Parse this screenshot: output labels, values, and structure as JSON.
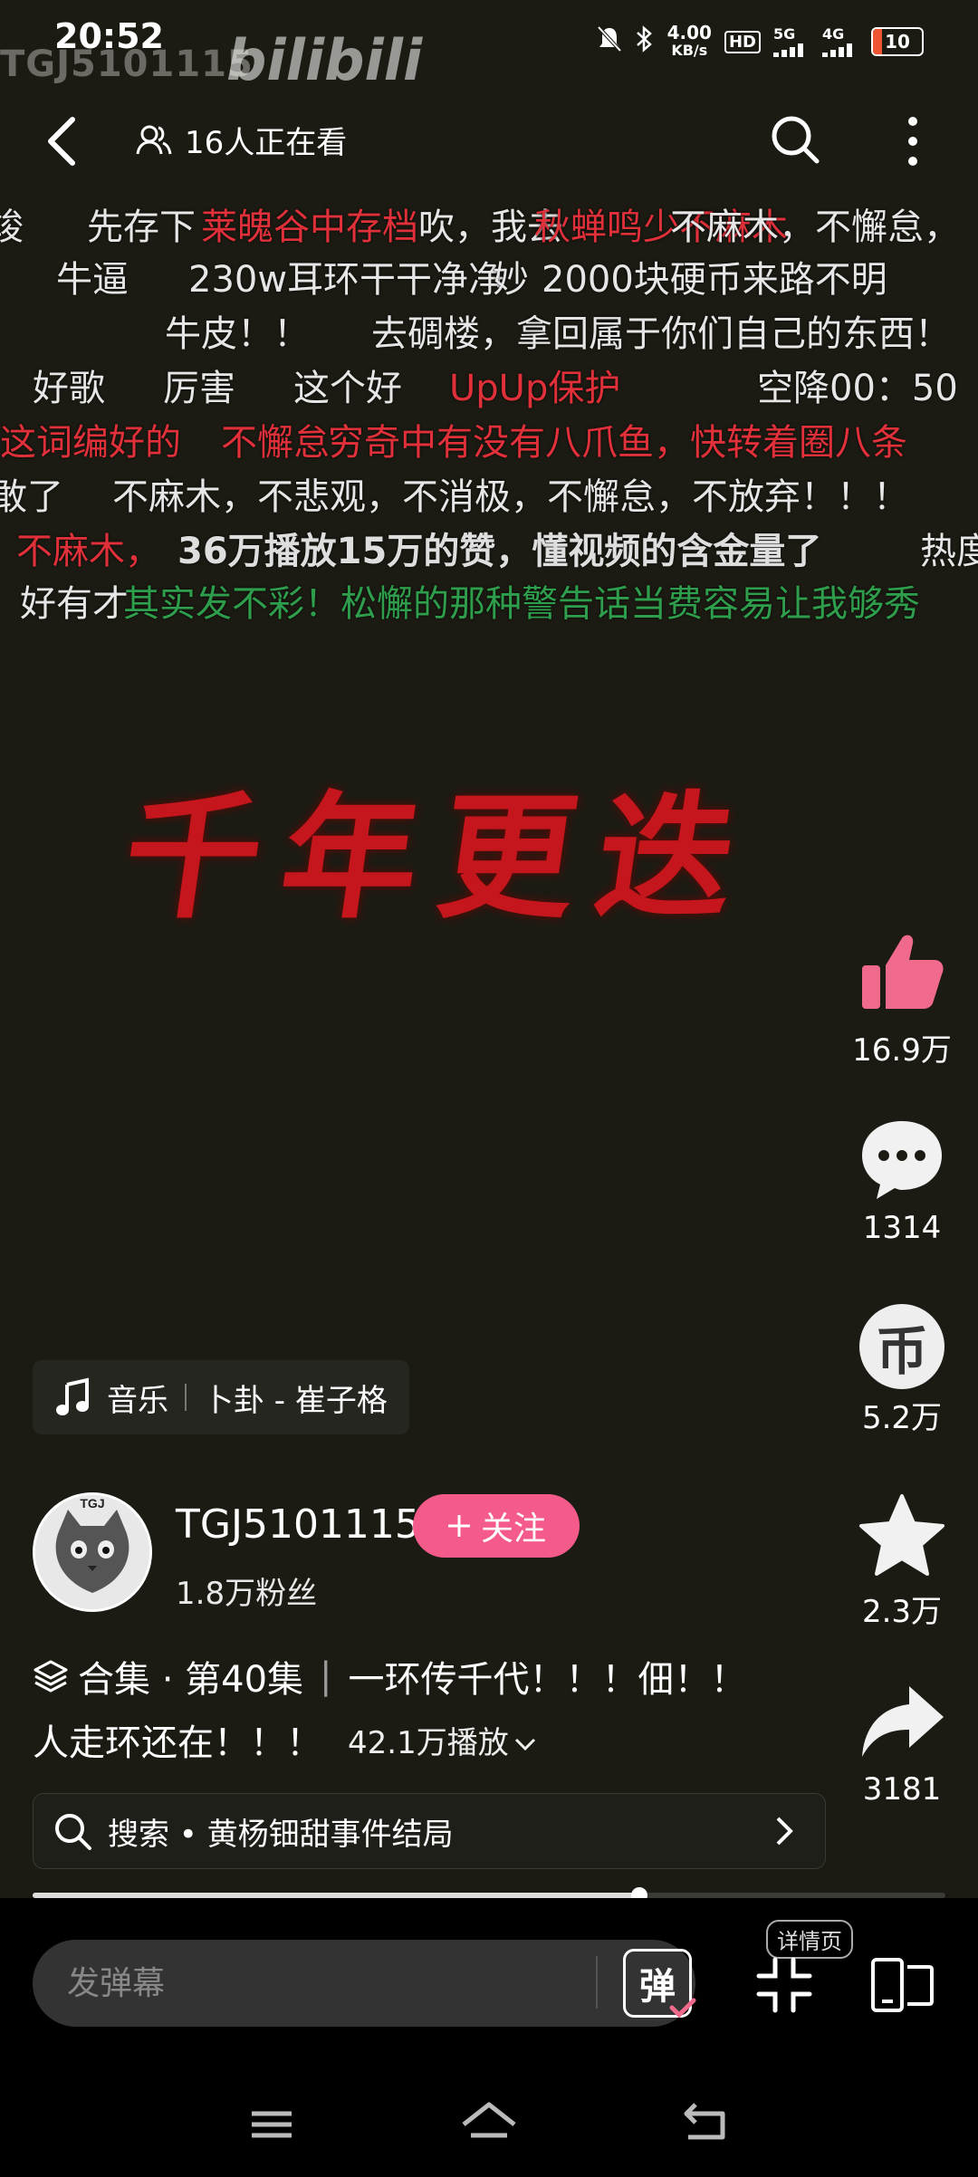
{
  "status": {
    "time": "20:52",
    "net_speed_top": "4.00",
    "net_speed_unit": "KB/s",
    "hd": "HD",
    "signal_1": "5G",
    "signal_2": "4G",
    "battery": "10"
  },
  "watermark": {
    "user": "TGJ5101115",
    "logo": "bilibili"
  },
  "topbar": {
    "viewers": "16人正在看"
  },
  "danmaku": [
    {
      "text": "竣",
      "color": "w"
    },
    {
      "text": "先存下",
      "color": "w"
    },
    {
      "text": "莱魄谷中存档",
      "color": "r"
    },
    {
      "text": "吹，我去",
      "color": "w"
    },
    {
      "text": "秋蝉鸣少不麻木",
      "color": "r"
    },
    {
      "text": "不麻木，不懈怠，",
      "color": "w"
    },
    {
      "text": "牛逼",
      "color": "w"
    },
    {
      "text": "230w耳环干干净净",
      "color": "w"
    },
    {
      "text": "妙",
      "color": "w"
    },
    {
      "text": "2000块硬币来路不明",
      "color": "w"
    },
    {
      "text": "牛皮！！",
      "color": "w"
    },
    {
      "text": "去碉楼，拿回属于你们自己的东西！",
      "color": "w"
    },
    {
      "text": "好歌",
      "color": "w"
    },
    {
      "text": "厉害",
      "color": "w"
    },
    {
      "text": "这个好",
      "color": "w"
    },
    {
      "text": "UpUp保护",
      "color": "r"
    },
    {
      "text": "空降00：50",
      "color": "w"
    },
    {
      "text": "这词编好的",
      "color": "r"
    },
    {
      "text": "不懈怠",
      "color": "r"
    },
    {
      "text": "穷奇中有没有八爪鱼，快转着圈八条",
      "color": "r"
    },
    {
      "text": "敢了",
      "color": "w"
    },
    {
      "text": "不麻木，不悲观，不消极，不懈怠，不放弃！！！",
      "color": "w"
    },
    {
      "text": "不麻木，",
      "color": "r"
    },
    {
      "text": "36万播放15万的赞，懂视频的含金量了",
      "color": "b"
    },
    {
      "text": "热度",
      "color": "w"
    },
    {
      "text": "好有才",
      "color": "w"
    },
    {
      "text": "其实发不彩！松懈的那种警告话当费容易让我够秀",
      "color": "g"
    }
  ],
  "video": {
    "title_art": "千年更迭"
  },
  "rail": {
    "likes": "16.9万",
    "comments": "1314",
    "coins": "5.2万",
    "favorites": "2.3万",
    "shares": "3181"
  },
  "music": {
    "label": "音乐",
    "song": "卜卦 - 崔子格"
  },
  "author": {
    "avatar_text": "TGJ",
    "name": "TGJ5101115",
    "follow_label": "关注",
    "fans": "1.8万粉丝"
  },
  "description": {
    "collection": "合集 · 第40集",
    "line1_text": "一环传千代！！！佃！！",
    "line2_text": "人走环还在！！！",
    "plays": "42.1万播放"
  },
  "search_suggestion": {
    "text": "搜索 • 黄杨钿甜事件结局"
  },
  "progress": {
    "played_fraction": 0.665
  },
  "bottom": {
    "danmaku_placeholder": "发弹幕",
    "danmaku_toggle": "弹",
    "detail_tip": "详情页"
  },
  "colors": {
    "accent_pink": "#f45b8b",
    "like_pink": "#f06a8c",
    "danmaku_red": "#e0303a",
    "danmaku_green": "#2e9e4c"
  }
}
